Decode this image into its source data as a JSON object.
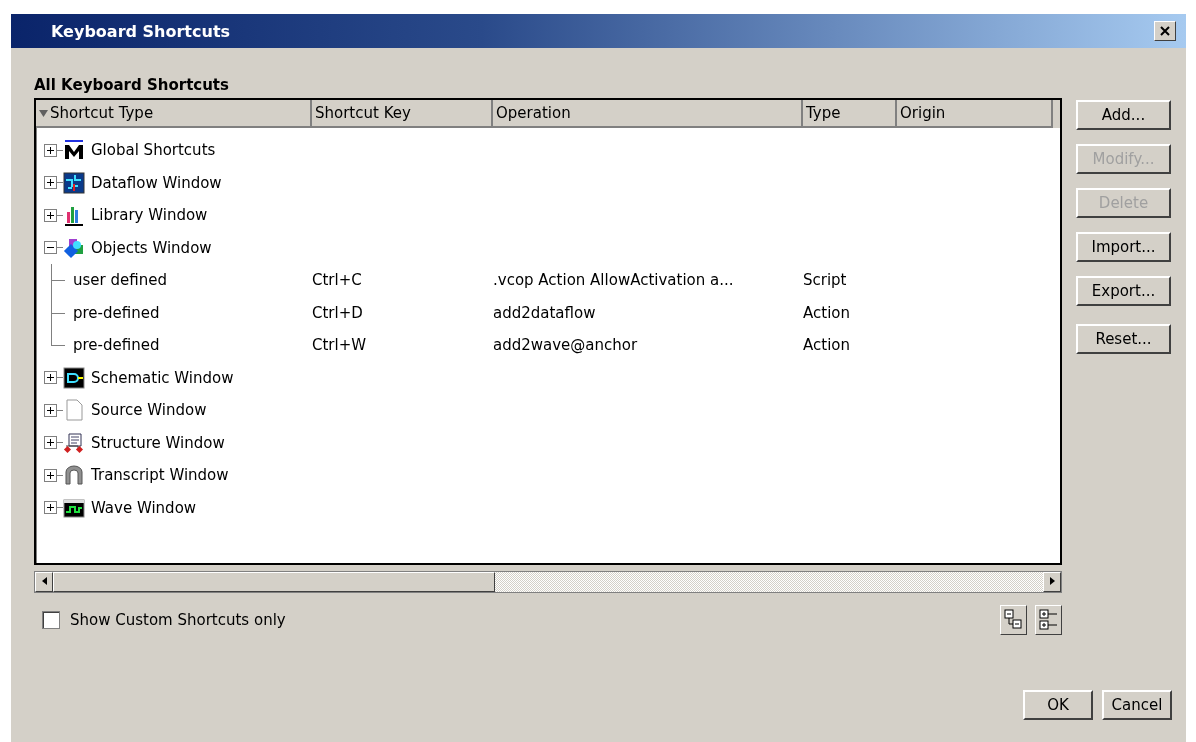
{
  "window": {
    "title": "Keyboard Shortcuts"
  },
  "section_title": "All Keyboard Shortcuts",
  "table": {
    "columns": [
      "Shortcut Type",
      "Shortcut Key",
      "Operation",
      "Type",
      "Origin"
    ],
    "rows": [
      {
        "label": "Global Shortcuts",
        "expanded": false
      },
      {
        "label": "Dataflow Window",
        "expanded": false
      },
      {
        "label": "Library Window",
        "expanded": false
      },
      {
        "label": "Objects Window",
        "expanded": true,
        "children": [
          {
            "label": "user defined",
            "key": "Ctrl+C",
            "operation": ".vcop Action AllowActivation a...",
            "type": "Script"
          },
          {
            "label": "pre-defined",
            "key": "Ctrl+D",
            "operation": "add2dataflow",
            "type": "Action"
          },
          {
            "label": "pre-defined",
            "key": "Ctrl+W",
            "operation": "add2wave@anchor",
            "type": "Action"
          }
        ]
      },
      {
        "label": "Schematic Window",
        "expanded": false
      },
      {
        "label": "Source Window",
        "expanded": false
      },
      {
        "label": "Structure Window",
        "expanded": false
      },
      {
        "label": "Transcript Window",
        "expanded": false
      },
      {
        "label": "Wave Window",
        "expanded": false
      }
    ]
  },
  "side_buttons": [
    {
      "label": "Add...",
      "disabled": false
    },
    {
      "label": "Modify...",
      "disabled": true
    },
    {
      "label": "Delete",
      "disabled": true
    },
    {
      "label": "Import...",
      "disabled": false
    },
    {
      "label": "Export...",
      "disabled": false
    },
    {
      "label": "Reset...",
      "disabled": false
    }
  ],
  "show_custom_only": {
    "label": "Show Custom Shortcuts only",
    "checked": false
  },
  "buttons": [
    "OK",
    "Cancel"
  ]
}
